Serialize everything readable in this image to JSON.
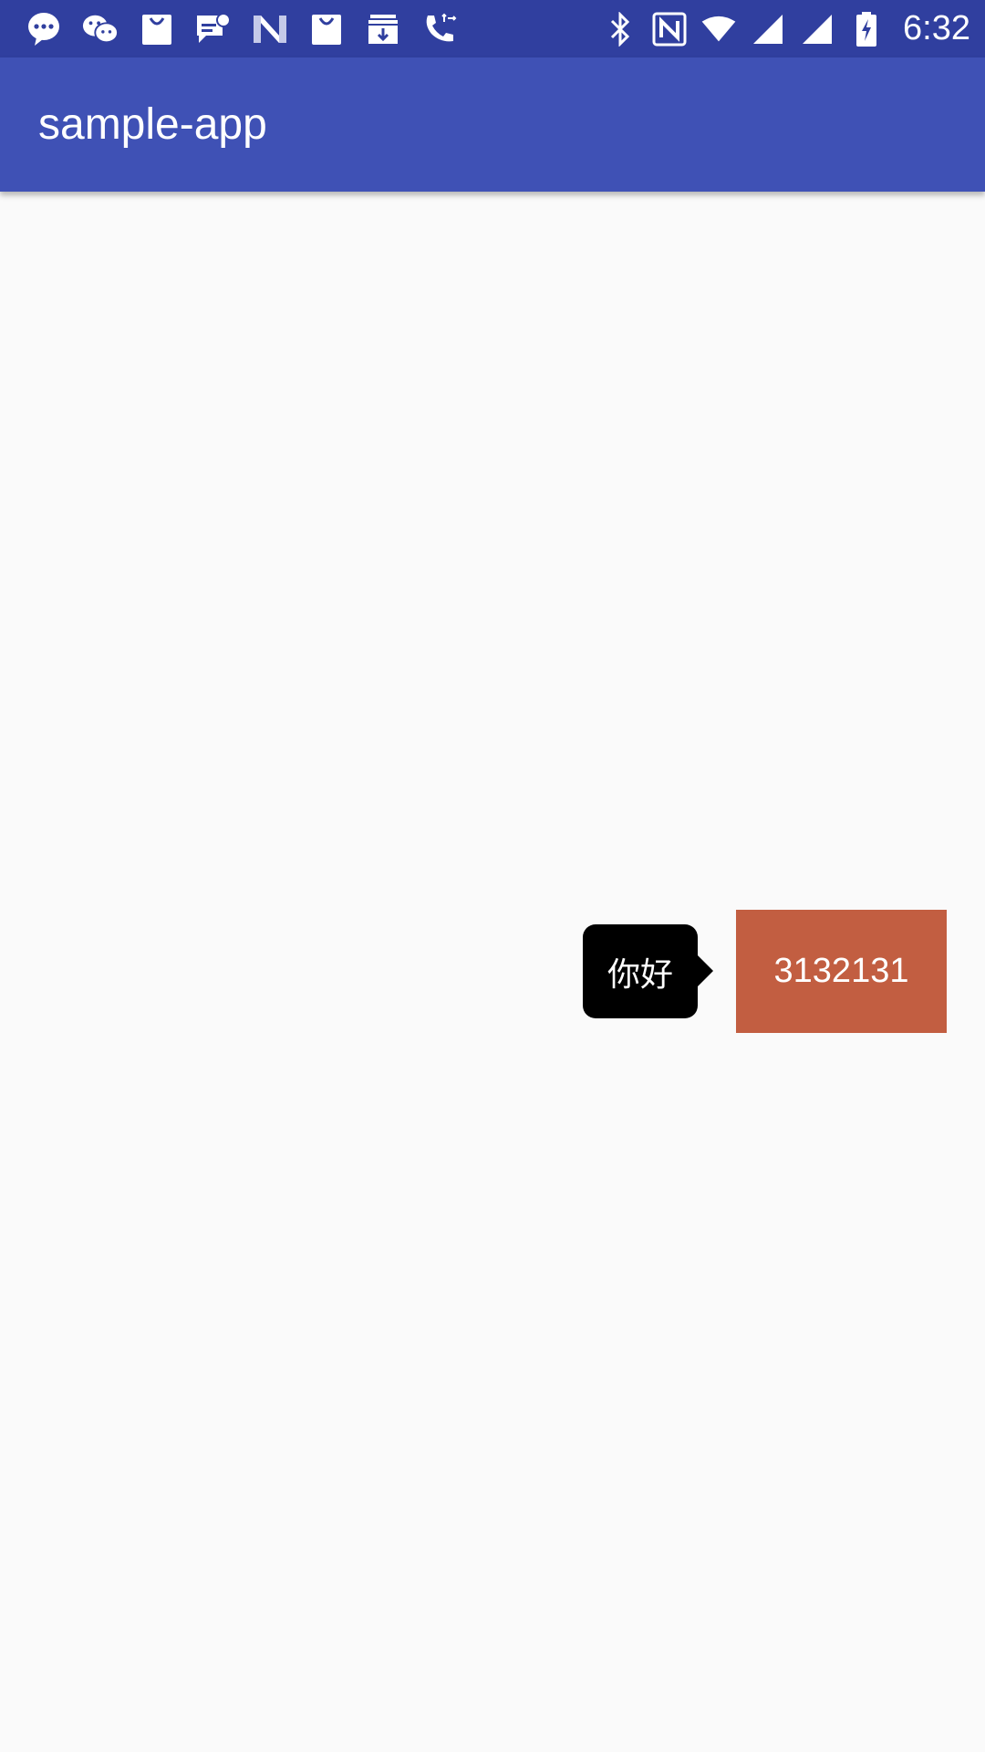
{
  "status_bar": {
    "time": "6:32",
    "left_icons": [
      "message-icon",
      "wechat-icon",
      "shopping-bag-icon",
      "chat-notification-icon",
      "n-app-icon",
      "shopping-bag-icon",
      "archive-download-icon",
      "phone-forward-icon"
    ],
    "right_icons": [
      "bluetooth-icon",
      "nfc-icon",
      "wifi-icon",
      "signal-icon",
      "signal-icon",
      "battery-charging-icon"
    ]
  },
  "app_bar": {
    "title": "sample-app"
  },
  "tooltip": {
    "text": "你好"
  },
  "target_button": {
    "label": "3132131"
  },
  "colors": {
    "status_bar": "#303F9F",
    "app_bar": "#3F51B5",
    "background": "#FAFAFA",
    "button": "#C25E41",
    "tooltip": "#000000"
  }
}
